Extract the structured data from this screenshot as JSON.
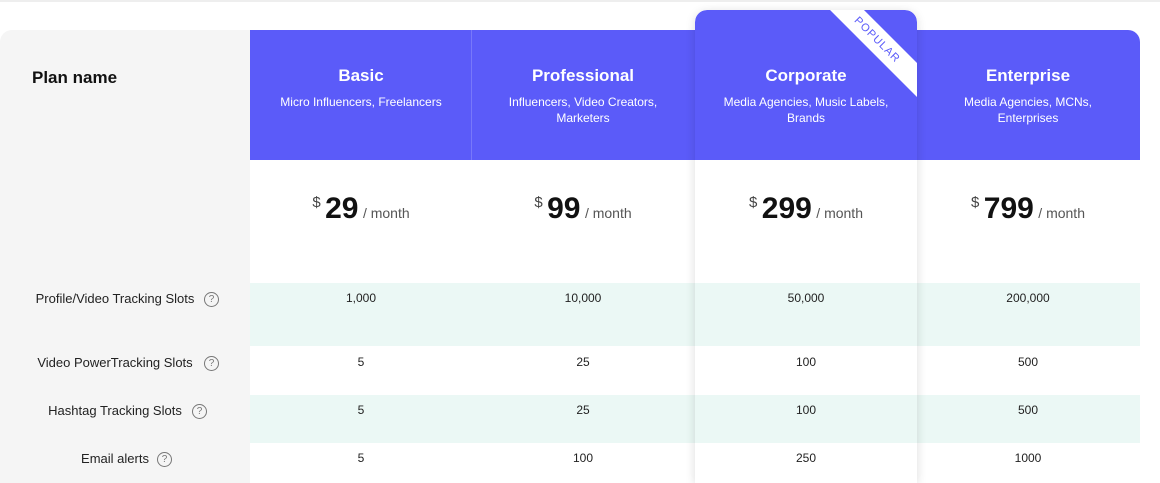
{
  "table": {
    "plan_name_label": "Plan name",
    "popular_badge": "POPULAR",
    "plans": [
      {
        "name": "Basic",
        "audience": "Micro Influencers, Freelancers",
        "currency": "$",
        "price": "29",
        "period": "/  month",
        "values": [
          "1,000",
          "5",
          "5",
          "5"
        ]
      },
      {
        "name": "Professional",
        "audience": "Influencers, Video Creators, Marketers",
        "currency": "$",
        "price": "99",
        "period": "/  month",
        "values": [
          "10,000",
          "25",
          "25",
          "100"
        ]
      },
      {
        "name": "Corporate",
        "audience": "Media Agencies, Music Labels, Brands",
        "currency": "$",
        "price": "299",
        "period": "/  month",
        "values": [
          "50,000",
          "100",
          "100",
          "250"
        ]
      },
      {
        "name": "Enterprise",
        "audience": "Media Agencies, MCNs, Enterprises",
        "currency": "$",
        "price": "799",
        "period": "/  month",
        "values": [
          "200,000",
          "500",
          "500",
          "1000"
        ]
      }
    ],
    "features": [
      {
        "label": "Profile/Video Tracking Slots",
        "help": "?"
      },
      {
        "label": "Video PowerTracking Slots",
        "help": "?"
      },
      {
        "label": "Hashtag Tracking Slots",
        "help": "?"
      },
      {
        "label": "Email alerts",
        "help": "?"
      }
    ]
  },
  "colors": {
    "header": "#5b5bf9",
    "row_tint": "#ebf8f5",
    "label_bg": "#f5f5f5"
  },
  "icons": {
    "help": "question-circle-icon"
  }
}
